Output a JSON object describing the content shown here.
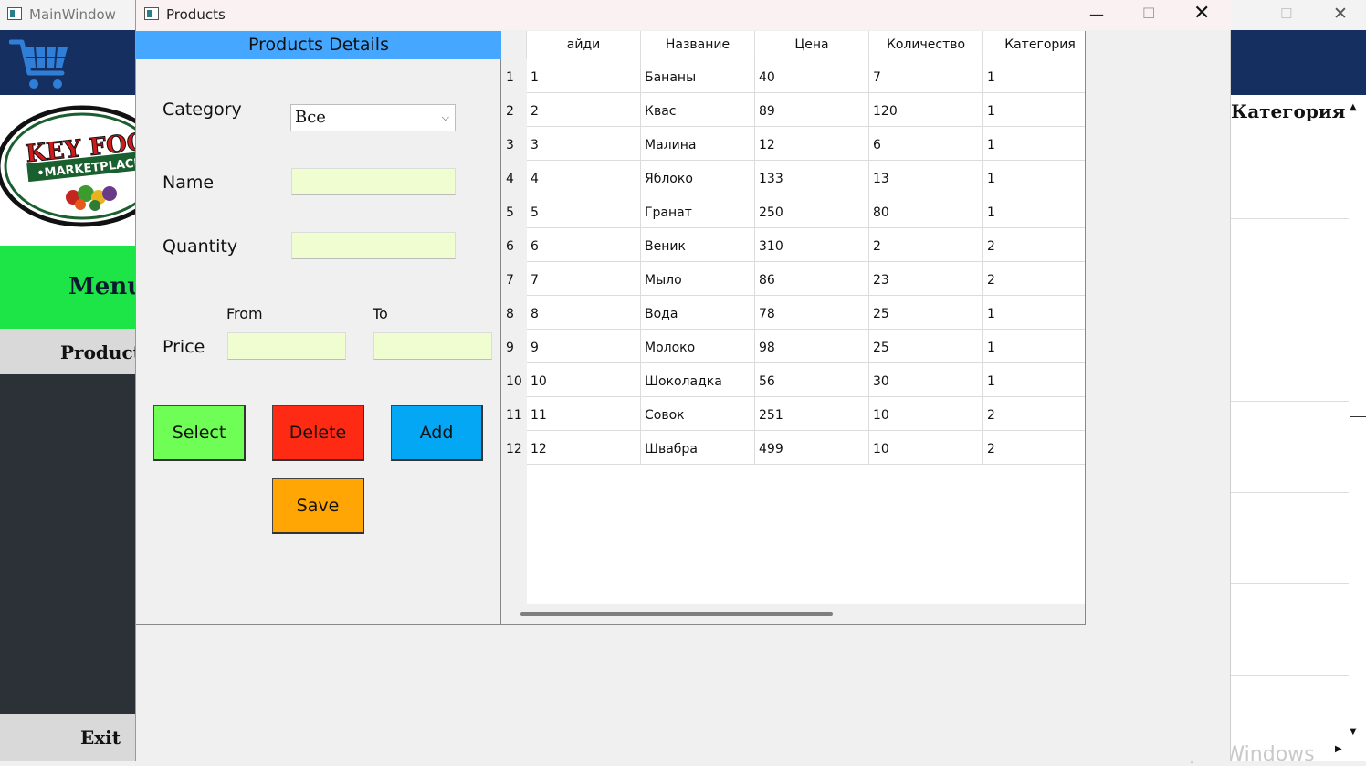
{
  "background_window": {
    "title": "MainWindow",
    "maximize_glyph": "☐",
    "close_glyph": "✕",
    "cart_icon": "shopping-cart-icon",
    "logo_text": "KEY FOOD MARKETPLACE",
    "menu_label": "Menu",
    "products_label": "Products",
    "exit_label": "Exit",
    "table_header": "Категория",
    "activation_text": "Активация Windows"
  },
  "window": {
    "title": "Products",
    "minimize_glyph": "—",
    "maximize_glyph": "☐",
    "close_glyph": "✕"
  },
  "details": {
    "header": "Products Details",
    "category_label": "Category",
    "category_value": "Все",
    "name_label": "Name",
    "name_value": "",
    "quantity_label": "Quantity",
    "quantity_value": "",
    "price_label": "Price",
    "from_label": "From",
    "to_label": "To",
    "price_from_value": "",
    "price_to_value": "",
    "buttons": {
      "select": "Select",
      "delete": "Delete",
      "add": "Add",
      "save": "Save"
    }
  },
  "colors": {
    "header_blue": "#45a7ff",
    "select_green": "#6efe55",
    "delete_red": "#ff2a14",
    "add_blue": "#04a7f4",
    "save_orange": "#ffa604",
    "field_bg": "#f0fdd0",
    "menu_green": "#1de547",
    "nav_dark": "#153060"
  },
  "table": {
    "columns": [
      "айди",
      "Название",
      "Цена",
      "Количество",
      "Категория"
    ],
    "rows": [
      [
        "1",
        "1",
        "Бананы",
        "40",
        "7",
        "1"
      ],
      [
        "2",
        "2",
        "Квас",
        "89",
        "120",
        "1"
      ],
      [
        "3",
        "3",
        "Малина",
        "12",
        "6",
        "1"
      ],
      [
        "4",
        "4",
        "Яблоко",
        "133",
        "13",
        "1"
      ],
      [
        "5",
        "5",
        "Гранат",
        "250",
        "80",
        "1"
      ],
      [
        "6",
        "6",
        "Веник",
        "310",
        "2",
        "2"
      ],
      [
        "7",
        "7",
        "Мыло",
        "86",
        "23",
        "2"
      ],
      [
        "8",
        "8",
        "Вода",
        "78",
        "25",
        "1"
      ],
      [
        "9",
        "9",
        "Молоко",
        "98",
        "25",
        "1"
      ],
      [
        "10",
        "10",
        "Шоколадка",
        "56",
        "30",
        "1"
      ],
      [
        "11",
        "11",
        "Совок",
        "251",
        "10",
        "2"
      ],
      [
        "12",
        "12",
        "Швабра",
        "499",
        "10",
        "2"
      ]
    ]
  }
}
